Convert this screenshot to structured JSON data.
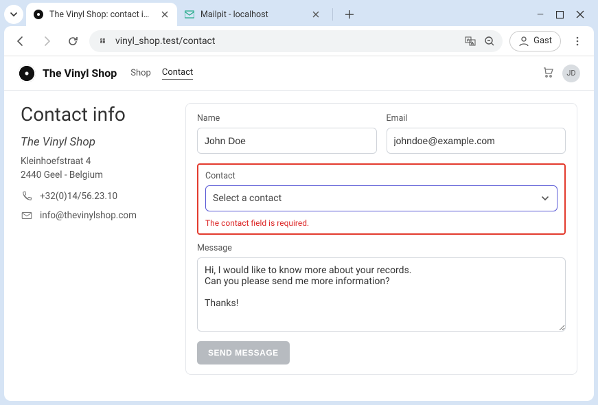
{
  "browser": {
    "tabs": [
      {
        "title": "The Vinyl Shop: contact info"
      },
      {
        "title": "Mailpit - localhost"
      }
    ],
    "url": "vinyl_shop.test/contact",
    "profile_label": "Gast"
  },
  "site": {
    "brand": "The Vinyl Shop",
    "nav": {
      "shop": "Shop",
      "contact": "Contact"
    },
    "avatar_initials": "JD"
  },
  "page": {
    "title": "Contact info"
  },
  "sidebar": {
    "shop_name": "The Vinyl Shop",
    "address_line1": "Kleinhoefstraat 4",
    "address_line2": "2440 Geel - Belgium",
    "phone": "+32(0)14/56.23.10",
    "email": "info@thevinylshop.com"
  },
  "form": {
    "name_label": "Name",
    "name_value": "John Doe",
    "email_label": "Email",
    "email_value": "johndoe@example.com",
    "contact_label": "Contact",
    "contact_placeholder": "Select a contact",
    "contact_error": "The contact field is required.",
    "message_label": "Message",
    "message_value": "Hi, I would like to know more about your records.\nCan you please send me more information?\n\nThanks!",
    "submit_label": "Send Message"
  }
}
